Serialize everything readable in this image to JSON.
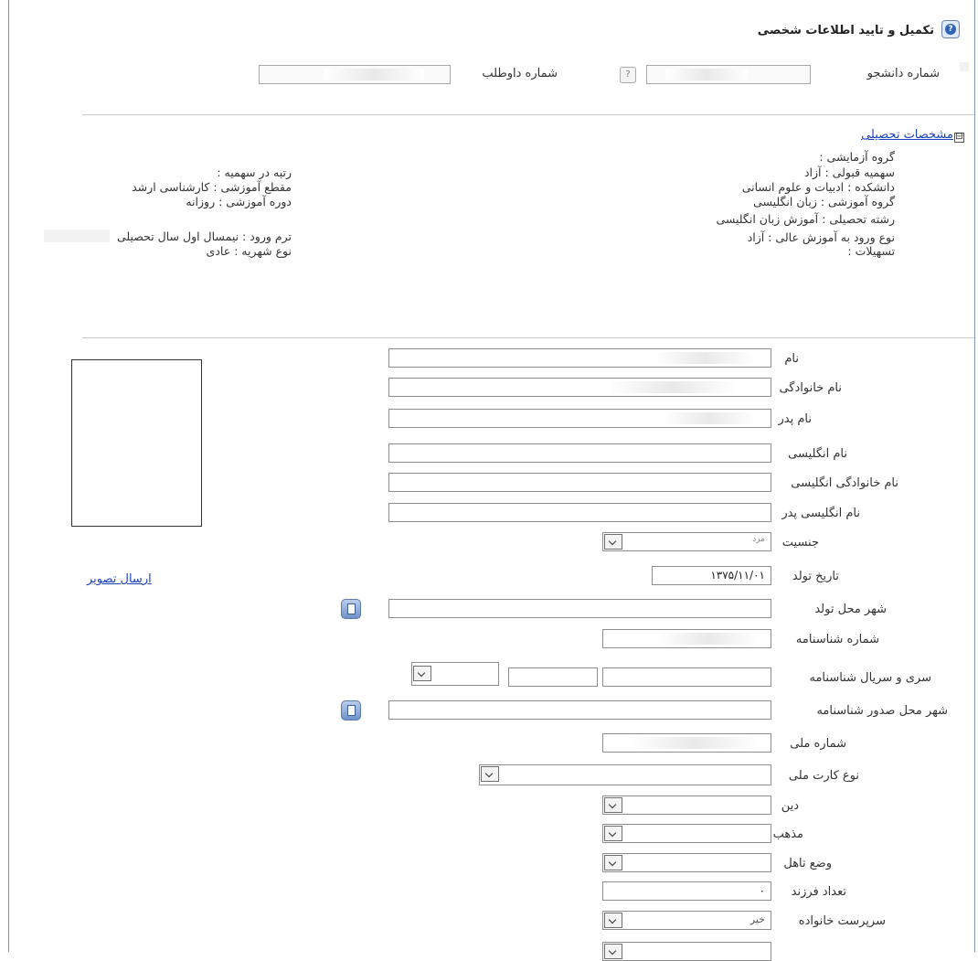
{
  "header": {
    "title": "تکمیل و تایید اطلاعات شخصی",
    "help_icon": "help-icon",
    "student_number_label": "شماره دانشجو",
    "candidate_number_label": "شماره داوطلب",
    "question_button": "?"
  },
  "academic": {
    "section_label": "مشخصات تحصیلی",
    "toggle": "⊟",
    "right_column": [
      "گروه آزمایشی :",
      "سهمیه قبولی : آزاد",
      "دانشکده : ادبیات و علوم انسانی",
      "گروه آموزشی : زبان انگلیسی",
      "رشته تحصیلی : آموزش زبان انگلیسی",
      "نوع ورود به آموزش عالی : آزاد",
      "تسهیلات :"
    ],
    "left_column": {
      "quota_rank": "رتبه در سهمیه :",
      "degree": "مقطع آموزشی : کارشناسی ارشد",
      "course_type": "دوره آموزشی : روزانه",
      "entry_term": "ترم ورود : نیمسال اول سال تحصیلی",
      "tuition_type": "نوع شهریه : عادی"
    }
  },
  "form": {
    "send_photo_link": "ارسال تصویر",
    "fields": {
      "first_name": "نام",
      "last_name": "نام خانوادگی",
      "father_name": "نام پدر",
      "english_name": "نام انگلیسی",
      "english_last_name": "نام خانوادگی انگلیسی",
      "english_father_name": "نام انگلیسی پدر",
      "gender": "جنسیت",
      "birth_date": "تاریخ تولد",
      "birth_city": "شهر محل تولد",
      "id_number": "شماره شناسنامه",
      "id_serial": "سری و سریال شناسنامه",
      "id_issue_city": "شهر محل صدور شناسنامه",
      "national_code": "شماره ملی",
      "national_card_type": "نوع کارت ملی",
      "religion": "دین",
      "sect": "مذهب",
      "marital_status": "وضع تاهل",
      "children_count": "تعداد فرزند",
      "household_head": "سرپرست خانواده"
    },
    "values": {
      "gender": "مرد",
      "birth_date": "۱۳۷۵/۱۱/۰۱",
      "children_count": "۰",
      "household_head": "خیر"
    }
  }
}
